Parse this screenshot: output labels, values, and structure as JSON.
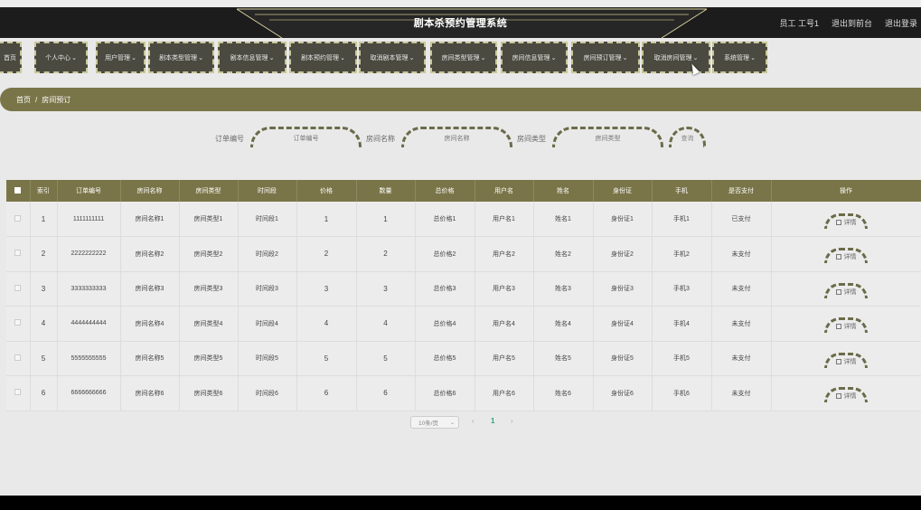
{
  "header": {
    "title": "剧本杀预约管理系统",
    "user_label": "员工 工号1",
    "front_label": "退出到前台",
    "logout_label": "退出登录"
  },
  "nav": {
    "items": [
      {
        "label": "首页",
        "has_menu": false
      },
      {
        "label": "个人中心",
        "has_menu": true
      },
      {
        "label": "用户管理",
        "has_menu": true
      },
      {
        "label": "剧本类型管理",
        "has_menu": true
      },
      {
        "label": "剧本信息管理",
        "has_menu": true
      },
      {
        "label": "剧本预约管理",
        "has_menu": true
      },
      {
        "label": "取消剧本管理",
        "has_menu": true
      },
      {
        "label": "房间类型管理",
        "has_menu": true
      },
      {
        "label": "房间信息管理",
        "has_menu": true
      },
      {
        "label": "房间预订管理",
        "has_menu": true
      },
      {
        "label": "取消房间管理",
        "has_menu": true
      },
      {
        "label": "系统管理",
        "has_menu": true
      }
    ]
  },
  "breadcrumb": {
    "home": "首页",
    "separator": "/",
    "current": "房间预订"
  },
  "search": {
    "order_label": "订单编号",
    "order_placeholder": "订单编号",
    "room_name_label": "房间名称",
    "room_name_placeholder": "房间名称",
    "room_type_label": "房间类型",
    "room_type_placeholder": "房间类型",
    "query_label": "查询"
  },
  "table": {
    "headers": [
      "索引",
      "订单编号",
      "房间名称",
      "房间类型",
      "时间段",
      "价格",
      "数量",
      "总价格",
      "用户名",
      "姓名",
      "身份证",
      "手机",
      "是否支付",
      "操作"
    ],
    "detail_label": "详情",
    "rows": [
      [
        "1",
        "1111111111",
        "房间名称1",
        "房间类型1",
        "时间段1",
        "1",
        "1",
        "总价格1",
        "用户名1",
        "姓名1",
        "身份证1",
        "手机1",
        "已支付"
      ],
      [
        "2",
        "2222222222",
        "房间名称2",
        "房间类型2",
        "时间段2",
        "2",
        "2",
        "总价格2",
        "用户名2",
        "姓名2",
        "身份证2",
        "手机2",
        "未支付"
      ],
      [
        "3",
        "3333333333",
        "房间名称3",
        "房间类型3",
        "时间段3",
        "3",
        "3",
        "总价格3",
        "用户名3",
        "姓名3",
        "身份证3",
        "手机3",
        "未支付"
      ],
      [
        "4",
        "4444444444",
        "房间名称4",
        "房间类型4",
        "时间段4",
        "4",
        "4",
        "总价格4",
        "用户名4",
        "姓名4",
        "身份证4",
        "手机4",
        "未支付"
      ],
      [
        "5",
        "5555555555",
        "房间名称5",
        "房间类型5",
        "时间段5",
        "5",
        "5",
        "总价格5",
        "用户名5",
        "姓名5",
        "身份证5",
        "手机5",
        "未支付"
      ],
      [
        "6",
        "6666666666",
        "房间名称6",
        "房间类型6",
        "时间段6",
        "6",
        "6",
        "总价格6",
        "用户名6",
        "姓名6",
        "身份证6",
        "手机6",
        "未支付"
      ]
    ]
  },
  "pagination": {
    "page_size_label": "10条/页",
    "current_page": "1",
    "prev_icon": "‹",
    "next_icon": "›"
  },
  "colors": {
    "accent": "#7a7548",
    "header_bg": "#1c1c1c",
    "nav_bg": "#4a4a40",
    "dashed_border": "#6b6b4a",
    "active_page": "#2aa574"
  }
}
